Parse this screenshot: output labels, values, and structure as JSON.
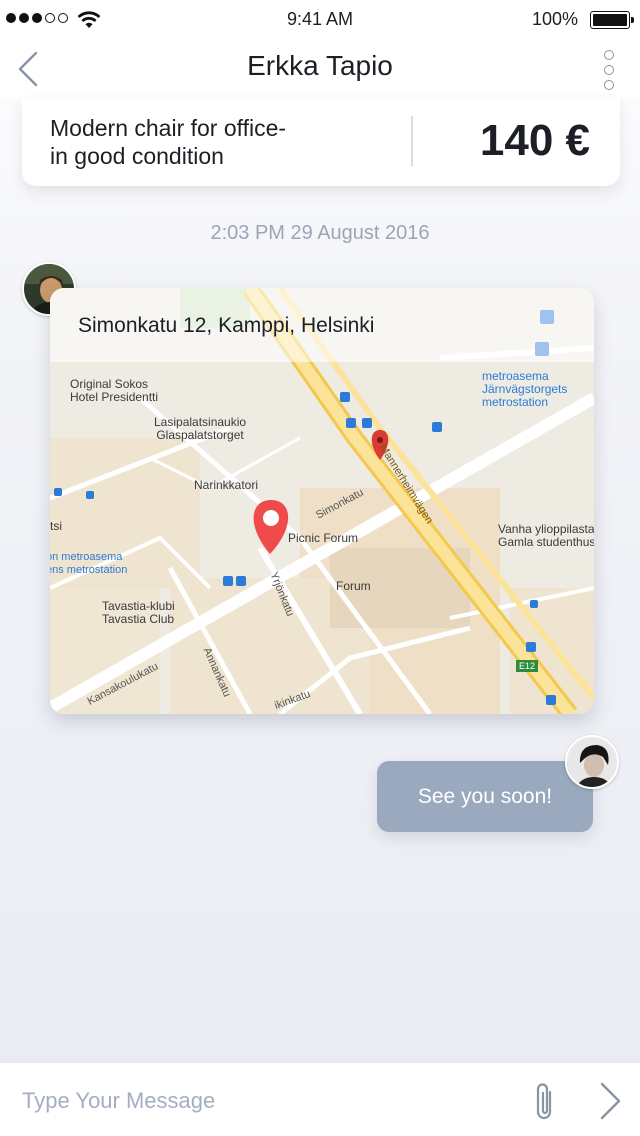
{
  "status_bar": {
    "time": "9:41 AM",
    "battery": "100%",
    "signal_icon": "signal-dots-icon",
    "wifi_icon": "wifi-icon",
    "battery_icon": "battery-icon"
  },
  "nav": {
    "title": "Erkka Tapio",
    "back_icon": "chevron-left-icon",
    "more_icon": "more-vertical-icon"
  },
  "product": {
    "description_line1": "Modern chair for office-",
    "description_line2": "in good condition",
    "price": "140 €"
  },
  "conversation": {
    "timestamp": "2:03 PM  29 August 2016",
    "map_message": {
      "address": "Simonkatu 12, Kamppi, Helsinki",
      "labels": {
        "sokos_1": "Original Sokos",
        "sokos_2": "Hotel Presidentti",
        "lasi_1": "Lasipalatsinaukio",
        "lasi_2": "Glaspalatstorget",
        "narinkka": "Narinkkatori",
        "simonkatu": "Simonkatu",
        "mannerheimintie": "Mannerheimvägen",
        "picnic": "Picnic Forum",
        "forum": "Forum",
        "metro_right_1": "metroasema",
        "metro_right_2": "Järnvägstorgets",
        "metro_right_3": "metrostation",
        "vanha_1": "Vanha ylioppilasta",
        "vanha_2": "Gamla studenthus",
        "metro_left_1": "tsi",
        "metro_left_2": "on metroasema",
        "metro_left_3": "ens metrostation",
        "tavastia_1": "Tavastia-klubi",
        "tavastia_2": "Tavastia Club",
        "yrjonkatu": "Yrjönkatu",
        "annankatu": "Annankatu",
        "kansakoulukatu": "Kansakoulukatu",
        "kinkatu": "ikinkatu",
        "e12": "E12"
      }
    },
    "outgoing_message": "See you soon!"
  },
  "composer": {
    "placeholder": "Type Your Message",
    "value": "",
    "attach_icon": "paperclip-icon",
    "send_icon": "chevron-right-icon"
  },
  "colors": {
    "bubble": "#9aa9bd",
    "pin": "#ef4b4b",
    "muted_text": "#9aa6b8",
    "icon": "#8894a6"
  }
}
